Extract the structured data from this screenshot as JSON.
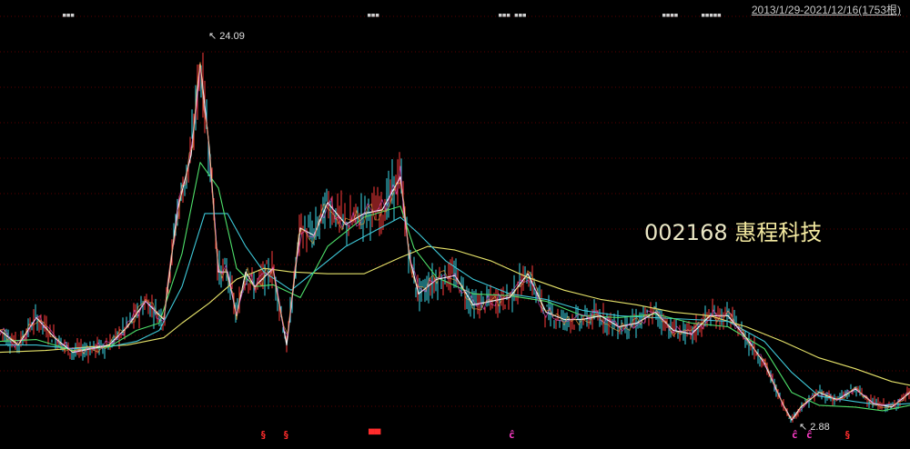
{
  "header": {
    "range_label": "2013/1/29-2021/12/16(1753根)"
  },
  "stock": {
    "code": "002168",
    "name": "惠程科技"
  },
  "annotations": {
    "high": "24.09",
    "low": "2.88"
  },
  "top_markers": [
    {
      "id": "m1",
      "text": "▪▪▪"
    },
    {
      "id": "m2",
      "text": "▪▪▪"
    },
    {
      "id": "m3",
      "text": "▪▪▪ ▪▪▪"
    },
    {
      "id": "m4",
      "text": "▪▪▪▪"
    },
    {
      "id": "m5",
      "text": "▪▪▪▪▪"
    }
  ],
  "bottom_markers": [
    {
      "id": "b1",
      "text": "§",
      "color": "red"
    },
    {
      "id": "b2",
      "text": "§",
      "color": "red"
    },
    {
      "id": "b3",
      "text": "▀▀",
      "color": "red"
    },
    {
      "id": "b4",
      "text": "ĉ",
      "color": "pink"
    },
    {
      "id": "b5",
      "text": "ĉ",
      "color": "pink"
    },
    {
      "id": "b6",
      "text": "ĉ",
      "color": "pink"
    },
    {
      "id": "b7",
      "text": "§",
      "color": "red"
    }
  ],
  "colors": {
    "background": "#000000",
    "grid": "#5a0000",
    "ma_yellow": "#e6e36a",
    "ma_cyan": "#3ec8d8",
    "ma_green": "#4ee06a",
    "ma_white": "#f0f0f0",
    "ma_magenta": "#e04cc8",
    "ma_orange": "#e8a03a",
    "candle_up": "#ff3c3c",
    "candle_down": "#3cd8e8"
  },
  "chart_data": {
    "type": "line",
    "title": "",
    "date_range": [
      "2013-01-29",
      "2021-12-16"
    ],
    "bar_count": 1753,
    "y_extremes": {
      "high": 24.09,
      "low": 2.88
    },
    "series": [
      {
        "color": "#e6e36a",
        "x": [
          0,
          50,
          100,
          140,
          180,
          200,
          230,
          260,
          290,
          320,
          360,
          400,
          440,
          470,
          500,
          540,
          580,
          620,
          660,
          700,
          740,
          780,
          820,
          860,
          900,
          940,
          980,
          1000
        ],
        "y": [
          6.6,
          6.7,
          6.9,
          7.0,
          7.4,
          8.2,
          9.3,
          10.6,
          11.2,
          11.0,
          10.9,
          10.9,
          11.8,
          12.4,
          12.2,
          11.6,
          10.7,
          10.0,
          9.5,
          9.2,
          8.8,
          8.6,
          8.0,
          7.2,
          6.3,
          5.7,
          5.0,
          4.8
        ]
      },
      {
        "color": "#3ec8d8",
        "x": [
          0,
          40,
          80,
          120,
          150,
          175,
          200,
          225,
          250,
          270,
          290,
          320,
          350,
          380,
          410,
          440,
          460,
          490,
          520,
          560,
          600,
          640,
          680,
          720,
          760,
          800,
          840,
          870,
          900,
          940,
          970,
          1000
        ],
        "y": [
          7.0,
          7.0,
          6.8,
          6.9,
          7.2,
          7.8,
          10.2,
          14.2,
          14.2,
          12.4,
          11.0,
          10.0,
          11.2,
          12.4,
          13.2,
          14.0,
          13.1,
          11.6,
          10.6,
          9.8,
          9.5,
          8.9,
          8.6,
          8.5,
          8.4,
          8.3,
          7.2,
          5.5,
          4.2,
          3.9,
          3.7,
          3.8
        ]
      },
      {
        "color": "#4ee06a",
        "x": [
          0,
          40,
          80,
          120,
          150,
          175,
          200,
          220,
          240,
          260,
          280,
          300,
          330,
          360,
          400,
          440,
          455,
          480,
          520,
          560,
          600,
          640,
          680,
          720,
          760,
          800,
          840,
          870,
          900,
          940,
          970,
          1000
        ],
        "y": [
          7.2,
          7.3,
          6.7,
          6.9,
          7.8,
          8.2,
          12.0,
          17.0,
          15.6,
          11.2,
          10.2,
          10.3,
          9.6,
          12.4,
          14.0,
          14.6,
          12.3,
          10.7,
          9.8,
          9.7,
          9.4,
          8.6,
          8.5,
          8.7,
          8.2,
          8.0,
          6.8,
          4.4,
          3.7,
          3.6,
          3.4,
          3.7
        ]
      },
      {
        "color": "#f0f0f0",
        "x": [
          0,
          20,
          40,
          60,
          80,
          100,
          120,
          140,
          160,
          180,
          195,
          210,
          220,
          230,
          240,
          250,
          260,
          270,
          280,
          300,
          315,
          330,
          345,
          360,
          380,
          400,
          420,
          440,
          450,
          460,
          480,
          500,
          520,
          540,
          560,
          580,
          600,
          620,
          640,
          660,
          680,
          700,
          720,
          740,
          760,
          780,
          800,
          820,
          840,
          860,
          870,
          880,
          900,
          920,
          940,
          960,
          980,
          1000
        ],
        "y": [
          7.8,
          7.0,
          8.5,
          7.4,
          6.6,
          6.8,
          7.0,
          8.0,
          9.4,
          8.4,
          14.4,
          17.4,
          22.4,
          17.8,
          11.0,
          11.0,
          8.6,
          11.0,
          10.2,
          11.2,
          7.0,
          13.4,
          13.0,
          14.8,
          13.6,
          14.2,
          14.4,
          16.2,
          11.8,
          9.8,
          10.6,
          10.8,
          9.2,
          9.4,
          9.6,
          10.9,
          8.8,
          8.4,
          8.4,
          8.6,
          8.0,
          8.2,
          8.8,
          7.8,
          7.6,
          8.6,
          8.6,
          7.4,
          6.0,
          3.8,
          2.9,
          3.6,
          4.4,
          4.0,
          4.6,
          3.8,
          3.6,
          4.4
        ]
      }
    ]
  }
}
